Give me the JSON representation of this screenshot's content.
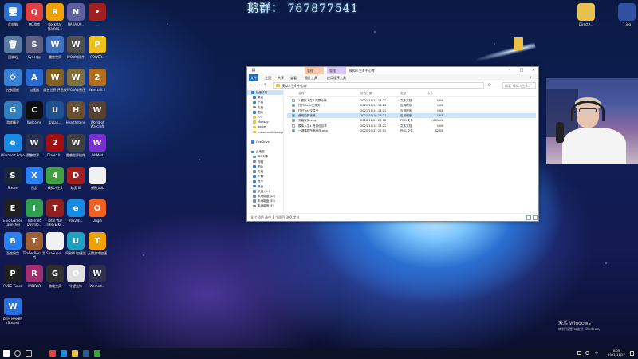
{
  "watermark": "鹅群： 767877541",
  "desktop_icons": [
    {
      "label": "此电脑",
      "color": "#2f6fd0",
      "glyph": "🖥"
    },
    {
      "label": "QQ游戏",
      "color": "#e04040",
      "glyph": "Q"
    },
    {
      "label": "Rockstar Games...",
      "color": "#f0a000",
      "glyph": "R"
    },
    {
      "label": "NARAKA...",
      "color": "#6060a0",
      "glyph": "N"
    },
    {
      "label": "...",
      "color": "#a02020",
      "glyph": "•"
    },
    {
      "label": "回收站",
      "color": "#5a7aa0",
      "glyph": "🗑"
    },
    {
      "label": "Synergy",
      "color": "#606080",
      "glyph": "S"
    },
    {
      "label": "魔兽世界",
      "color": "#4070c0",
      "glyph": "W"
    },
    {
      "label": "WOWQ插件",
      "color": "#505050",
      "glyph": "W"
    },
    {
      "label": "POWER..",
      "color": "#f0c020",
      "glyph": "P"
    },
    {
      "label": "控制面板",
      "color": "#3a80d0",
      "glyph": "⚙"
    },
    {
      "label": "加速器",
      "color": "#2a6ad0",
      "glyph": "A"
    },
    {
      "label": "魔兽世界 怀旧服",
      "color": "#806020",
      "glyph": "W"
    },
    {
      "label": "WOWQ怀旧",
      "color": "#807040",
      "glyph": "W"
    },
    {
      "label": "Warcraft II",
      "color": "#b07020",
      "glyph": "2"
    },
    {
      "label": "游戏精灵",
      "color": "#3080c0",
      "glyph": "G"
    },
    {
      "label": "Welcome",
      "color": "#101010",
      "glyph": "C"
    },
    {
      "label": "Uplay...",
      "color": "#205090",
      "glyph": "U"
    },
    {
      "label": "Hearthstone",
      "color": "#6a5030",
      "glyph": "H"
    },
    {
      "label": "World of Warcraft",
      "color": "#5a4030",
      "glyph": "W"
    },
    {
      "label": "Microsoft Edge",
      "color": "#1a8ae0",
      "glyph": "e"
    },
    {
      "label": "魔兽世界...",
      "color": "#2a3050",
      "glyph": "W"
    },
    {
      "label": "Diablo II...",
      "color": "#a01010",
      "glyph": "2"
    },
    {
      "label": "魔兽世界插件",
      "color": "#404040",
      "glyph": "W"
    },
    {
      "label": "WeMod",
      "color": "#7a30d0",
      "glyph": "W"
    },
    {
      "label": "Steam",
      "color": "#1b2838",
      "glyph": "S"
    },
    {
      "label": "迅游",
      "color": "#2a80f0",
      "glyph": "X"
    },
    {
      "label": "模拟人生4",
      "color": "#40a040",
      "glyph": "4"
    },
    {
      "label": "暗黑 III",
      "color": "#a02020",
      "glyph": "D"
    },
    {
      "label": "新建文本",
      "color": "#f0f0f0",
      "glyph": " "
    },
    {
      "label": "Epic Games Launcher",
      "color": "#202020",
      "glyph": "E"
    },
    {
      "label": "Internet Downlo...",
      "color": "#30a050",
      "glyph": "I"
    },
    {
      "label": "Total War THREE KI...",
      "color": "#902020",
      "glyph": "T"
    },
    {
      "label": "2022年...",
      "color": "#1a8ae0",
      "glyph": "e"
    },
    {
      "label": "Origin",
      "color": "#f06020",
      "glyph": "O"
    },
    {
      "label": "百度网盘",
      "color": "#2a80f0",
      "glyph": "B"
    },
    {
      "label": "TimberBorn 游戏",
      "color": "#a06030",
      "glyph": "T"
    },
    {
      "label": "SeaSurvi...",
      "color": "#f0f0f0",
      "glyph": " "
    },
    {
      "label": "网易UU加速器",
      "color": "#20a0c0",
      "glyph": "U"
    },
    {
      "label": "天翼游戏加速",
      "color": "#f0a000",
      "glyph": "T"
    },
    {
      "label": "PUBG Tuner",
      "color": "#202020",
      "glyph": "P"
    },
    {
      "label": "WINRAR",
      "color": "#a03070",
      "glyph": "R"
    },
    {
      "label": "游戏工具",
      "color": "#303030",
      "glyph": "G"
    },
    {
      "label": "守望先锋",
      "color": "#e0e0e0",
      "glyph": "O"
    },
    {
      "label": "Wemod...",
      "color": "#303050",
      "glyph": "W"
    },
    {
      "label": "DTM MAKER (Steam)",
      "color": "#2a70e0",
      "glyph": "W"
    }
  ],
  "right_icons": [
    {
      "label": "DirectX...",
      "color": "#e8c04c",
      "glyph": " "
    },
    {
      "label": "1.jpg",
      "color": "#3050a0",
      "glyph": " "
    }
  ],
  "explorer": {
    "title": "模拟人生4 中心库",
    "contextual_tabs": [
      "管理",
      "管理"
    ],
    "ribbon_tabs": [
      "文件",
      "主页",
      "共享",
      "查看",
      "图片工具",
      "应用程序工具"
    ],
    "address": "模拟人生4 中心库",
    "search_placeholder": "搜索\"模拟人生4...\"",
    "nav_items": [
      {
        "label": "快速访问",
        "sel": true,
        "color": "#3a80d0",
        "indent": false
      },
      {
        "label": "桌面",
        "sel": false,
        "color": "#3a80d0",
        "indent": true
      },
      {
        "label": "下载",
        "sel": false,
        "color": "#3a80d0",
        "indent": true
      },
      {
        "label": "文档",
        "sel": false,
        "color": "#7a8aa0",
        "indent": true
      },
      {
        "label": "图片",
        "sel": false,
        "color": "#3a80d0",
        "indent": true
      },
      {
        "label": "???",
        "sel": false,
        "color": "#e8c04c",
        "indent": true
      },
      {
        "label": "Modsay",
        "sel": false,
        "color": "#e8c04c",
        "indent": true
      },
      {
        "label": "game",
        "sel": false,
        "color": "#e8c04c",
        "indent": true
      },
      {
        "label": "mountandbladegame",
        "sel": false,
        "color": "#e8c04c",
        "indent": true
      },
      {
        "label": "",
        "sel": false,
        "color": "transparent",
        "indent": false
      },
      {
        "label": "OneDrive",
        "sel": false,
        "color": "#2a80f0",
        "indent": false
      },
      {
        "label": "",
        "sel": false,
        "color": "transparent",
        "indent": false
      },
      {
        "label": "此电脑",
        "sel": false,
        "color": "#3a80d0",
        "indent": false
      },
      {
        "label": "3D 对象",
        "sel": false,
        "color": "#3aa0d0",
        "indent": true
      },
      {
        "label": "视频",
        "sel": false,
        "color": "#7a8aa0",
        "indent": true
      },
      {
        "label": "图片",
        "sel": false,
        "color": "#3a80d0",
        "indent": true
      },
      {
        "label": "文档",
        "sel": false,
        "color": "#7a8aa0",
        "indent": true
      },
      {
        "label": "下载",
        "sel": false,
        "color": "#3a80d0",
        "indent": true
      },
      {
        "label": "音乐",
        "sel": false,
        "color": "#3a80d0",
        "indent": true
      },
      {
        "label": "桌面",
        "sel": false,
        "color": "#3a80d0",
        "indent": true
      },
      {
        "label": "系统 (C:)",
        "sel": false,
        "color": "#7a8aa0",
        "indent": true
      },
      {
        "label": "本地磁盘 (D:)",
        "sel": false,
        "color": "#7a8aa0",
        "indent": true
      },
      {
        "label": "本地磁盘 (E:)",
        "sel": false,
        "color": "#7a8aa0",
        "indent": true
      },
      {
        "label": "本地磁盘 (F:)",
        "sel": false,
        "color": "#7a8aa0",
        "indent": true
      }
    ],
    "columns": [
      "名称",
      "修改日期",
      "类型",
      "大小"
    ],
    "files": [
      {
        "name": "1.模拟人生4 同屏必读",
        "date": "2021/11/14 13:21",
        "type": "文本文档",
        "size": "1 KB",
        "sel": false,
        "color": "#ffffff"
      },
      {
        "name": "打开Mods文件夹",
        "date": "2021/11/14 13:21",
        "type": "应用程序",
        "size": "1 KB",
        "sel": false,
        "color": "#3a80d0"
      },
      {
        "name": "打开Tray文件夹",
        "date": "2021/11/14 13:21",
        "type": "应用程序",
        "size": "1 KB",
        "sel": false,
        "color": "#3a80d0"
      },
      {
        "name": "使用前先读我",
        "date": "2021/11/14 13:21",
        "type": "应用程序",
        "size": "1 KB",
        "sel": true,
        "color": "#3a80d0"
      },
      {
        "name": "安装汉化.png",
        "date": "2018/12/21 23:18",
        "type": "PNG 文件",
        "size": "1,085 KB",
        "sel": false,
        "color": "#40a0d0"
      },
      {
        "name": "模拟人生4 资源包目录",
        "date": "2021/11/14 13:21",
        "type": "文本文档",
        "size": "1 KB",
        "sel": false,
        "color": "#ffffff"
      },
      {
        "name": "一键清理所有缓存.png",
        "date": "2020/10/22 22:51",
        "type": "PNG 文件",
        "size": "82 KB",
        "sel": false,
        "color": "#40a0d0"
      }
    ],
    "status": "8 个项目    选中 1 个项目 300 字节"
  },
  "activation": {
    "line1": "激活 Windows",
    "line2": "转到\"设置\"以激活 Windows。"
  },
  "taskbar": {
    "time": "0:05",
    "date": "2021/11/27",
    "icons": [
      {
        "name": "start-icon",
        "color": "#ffffff"
      },
      {
        "name": "search-icon",
        "color": "#bbbbbb"
      },
      {
        "name": "task-view-icon",
        "color": "#bbbbbb"
      },
      {
        "name": "chrome-icon",
        "color": "#e04040"
      },
      {
        "name": "edge-icon",
        "color": "#1a8ae0"
      },
      {
        "name": "explorer-icon",
        "color": "#e8c04c"
      },
      {
        "name": "steam-icon",
        "color": "#2a5a8a"
      },
      {
        "name": "app-icon",
        "color": "#40a040"
      }
    ]
  }
}
